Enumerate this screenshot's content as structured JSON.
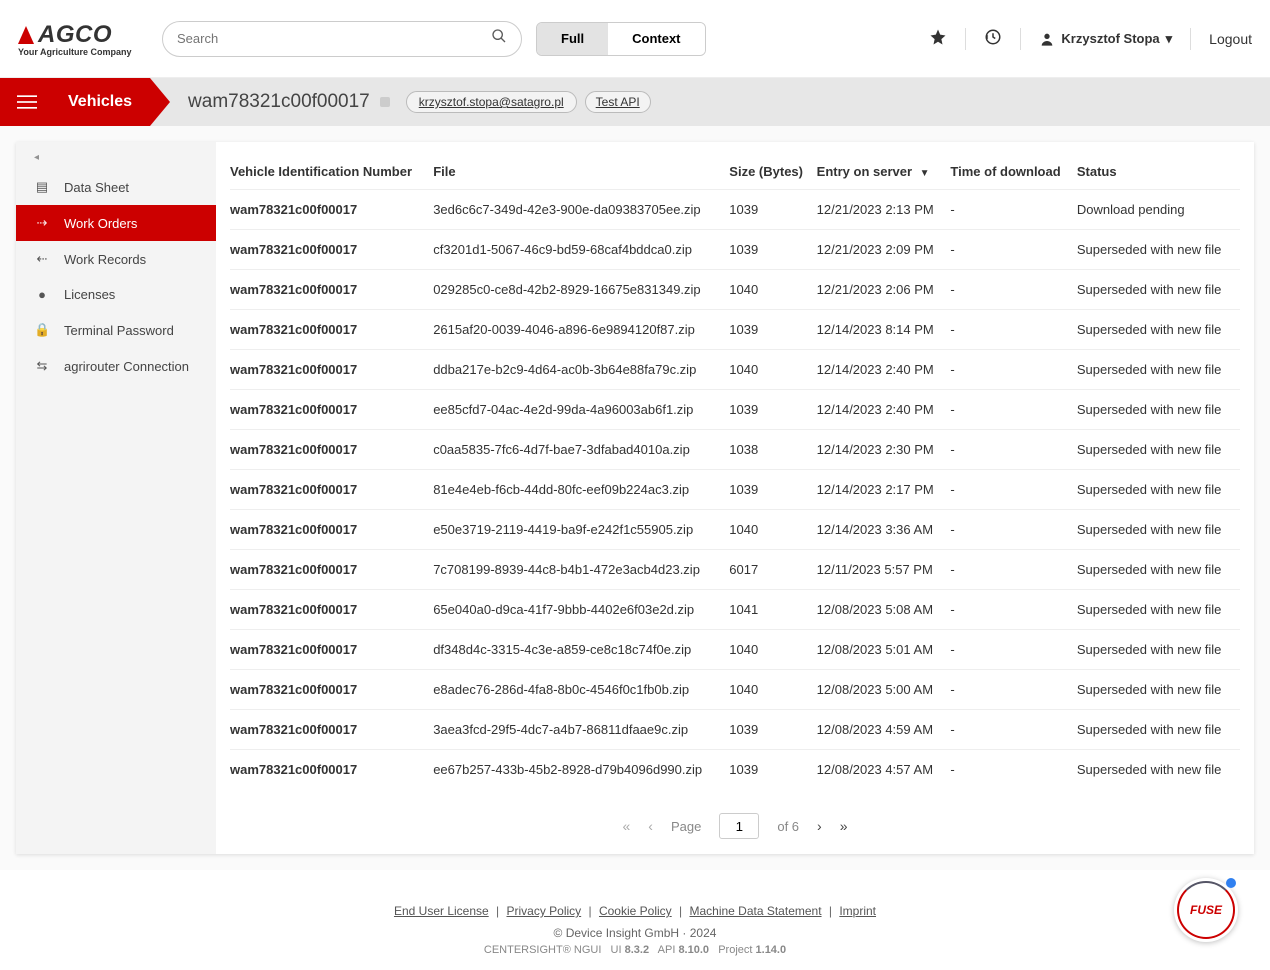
{
  "brand": {
    "name": "AGCO",
    "tagline": "Your Agriculture Company"
  },
  "search": {
    "placeholder": "Search"
  },
  "viewToggle": {
    "full": "Full",
    "context": "Context"
  },
  "user": {
    "name": "Krzysztof Stopa"
  },
  "logout": "Logout",
  "section": {
    "label": "Vehicles",
    "entityId": "wam78321c00f00017",
    "email": "krzysztof.stopa@satagro.pl",
    "testApi": "Test API"
  },
  "sidebar": {
    "items": [
      {
        "label": "Data Sheet"
      },
      {
        "label": "Work Orders"
      },
      {
        "label": "Work Records"
      },
      {
        "label": "Licenses"
      },
      {
        "label": "Terminal Password"
      },
      {
        "label": "agrirouter Connection"
      }
    ],
    "activeIndex": 1
  },
  "table": {
    "headers": {
      "vin": "Vehicle Identification Number",
      "file": "File",
      "size": "Size (Bytes)",
      "entry": "Entry on server",
      "dl": "Time of download",
      "status": "Status"
    },
    "rows": [
      {
        "vin": "wam78321c00f00017",
        "file": "3ed6c6c7-349d-42e3-900e-da09383705ee.zip",
        "size": "1039",
        "entry": "12/21/2023 2:13 PM",
        "dl": "-",
        "status": "Download pending"
      },
      {
        "vin": "wam78321c00f00017",
        "file": "cf3201d1-5067-46c9-bd59-68caf4bddca0.zip",
        "size": "1039",
        "entry": "12/21/2023 2:09 PM",
        "dl": "-",
        "status": "Superseded with new file"
      },
      {
        "vin": "wam78321c00f00017",
        "file": "029285c0-ce8d-42b2-8929-16675e831349.zip",
        "size": "1040",
        "entry": "12/21/2023 2:06 PM",
        "dl": "-",
        "status": "Superseded with new file"
      },
      {
        "vin": "wam78321c00f00017",
        "file": "2615af20-0039-4046-a896-6e9894120f87.zip",
        "size": "1039",
        "entry": "12/14/2023 8:14 PM",
        "dl": "-",
        "status": "Superseded with new file"
      },
      {
        "vin": "wam78321c00f00017",
        "file": "ddba217e-b2c9-4d64-ac0b-3b64e88fa79c.zip",
        "size": "1040",
        "entry": "12/14/2023 2:40 PM",
        "dl": "-",
        "status": "Superseded with new file"
      },
      {
        "vin": "wam78321c00f00017",
        "file": "ee85cfd7-04ac-4e2d-99da-4a96003ab6f1.zip",
        "size": "1039",
        "entry": "12/14/2023 2:40 PM",
        "dl": "-",
        "status": "Superseded with new file"
      },
      {
        "vin": "wam78321c00f00017",
        "file": "c0aa5835-7fc6-4d7f-bae7-3dfabad4010a.zip",
        "size": "1038",
        "entry": "12/14/2023 2:30 PM",
        "dl": "-",
        "status": "Superseded with new file"
      },
      {
        "vin": "wam78321c00f00017",
        "file": "81e4e4eb-f6cb-44dd-80fc-eef09b224ac3.zip",
        "size": "1039",
        "entry": "12/14/2023 2:17 PM",
        "dl": "-",
        "status": "Superseded with new file"
      },
      {
        "vin": "wam78321c00f00017",
        "file": "e50e3719-2119-4419-ba9f-e242f1c55905.zip",
        "size": "1040",
        "entry": "12/14/2023 3:36 AM",
        "dl": "-",
        "status": "Superseded with new file"
      },
      {
        "vin": "wam78321c00f00017",
        "file": "7c708199-8939-44c8-b4b1-472e3acb4d23.zip",
        "size": "6017",
        "entry": "12/11/2023 5:57 PM",
        "dl": "-",
        "status": "Superseded with new file"
      },
      {
        "vin": "wam78321c00f00017",
        "file": "65e040a0-d9ca-41f7-9bbb-4402e6f03e2d.zip",
        "size": "1041",
        "entry": "12/08/2023 5:08 AM",
        "dl": "-",
        "status": "Superseded with new file"
      },
      {
        "vin": "wam78321c00f00017",
        "file": "df348d4c-3315-4c3e-a859-ce8c18c74f0e.zip",
        "size": "1040",
        "entry": "12/08/2023 5:01 AM",
        "dl": "-",
        "status": "Superseded with new file"
      },
      {
        "vin": "wam78321c00f00017",
        "file": "e8adec76-286d-4fa8-8b0c-4546f0c1fb0b.zip",
        "size": "1040",
        "entry": "12/08/2023 5:00 AM",
        "dl": "-",
        "status": "Superseded with new file"
      },
      {
        "vin": "wam78321c00f00017",
        "file": "3aea3fcd-29f5-4dc7-a4b7-86811dfaae9c.zip",
        "size": "1039",
        "entry": "12/08/2023 4:59 AM",
        "dl": "-",
        "status": "Superseded with new file"
      },
      {
        "vin": "wam78321c00f00017",
        "file": "ee67b257-433b-45b2-8928-d79b4096d990.zip",
        "size": "1039",
        "entry": "12/08/2023 4:57 AM",
        "dl": "-",
        "status": "Superseded with new file"
      }
    ]
  },
  "pager": {
    "pageLabel": "Page",
    "page": "1",
    "ofLabel": "of 6"
  },
  "footer": {
    "links": [
      "End User License",
      "Privacy Policy",
      "Cookie Policy",
      "Machine Data Statement",
      "Imprint"
    ],
    "copyright": "© Device Insight GmbH · 2024",
    "versionPrefix": "CENTERSIGHT® NGUI",
    "uiLabel": "UI",
    "ui": "8.3.2",
    "apiLabel": "API",
    "api": "8.10.0",
    "projLabel": "Project",
    "proj": "1.14.0"
  },
  "fuse": "FUSE"
}
